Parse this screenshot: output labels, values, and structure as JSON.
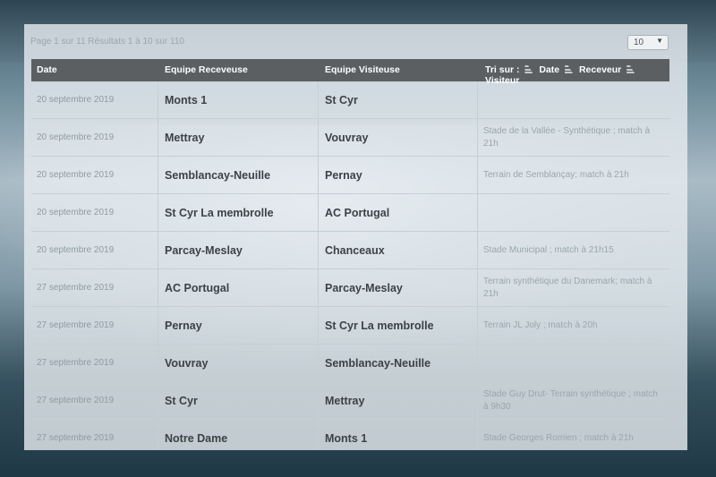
{
  "pager": {
    "info": "Page 1 sur 11 Résultats 1 à 10 sur 110",
    "per_page": "10",
    "per_page_arrow": "▼"
  },
  "columns": {
    "date": "Date",
    "home": "Equipe Receveuse",
    "away": "Equipe Visiteuse",
    "sort_label": "Tri sur :",
    "sort_date": "Date",
    "sort_home": "Receveur",
    "sort_away": "Visiteur"
  },
  "rows": [
    {
      "date": "20 septembre 2019",
      "home": "Monts 1",
      "away": "St Cyr",
      "info": ""
    },
    {
      "date": "20 septembre 2019",
      "home": "Mettray",
      "away": "Vouvray",
      "info": "Stade de la Vallée - Synthétique ; match à 21h"
    },
    {
      "date": "20 septembre 2019",
      "home": "Semblancay-Neuille",
      "away": "Pernay",
      "info": "Terrain de Semblançay; match à 21h"
    },
    {
      "date": "20 septembre 2019",
      "home": "St Cyr La membrolle",
      "away": "AC Portugal",
      "info": ""
    },
    {
      "date": "20 septembre 2019",
      "home": "Parcay-Meslay",
      "away": "Chanceaux",
      "info": "Stade Municipal ; match à 21h15"
    },
    {
      "date": "27 septembre 2019",
      "home": "AC Portugal",
      "away": "Parcay-Meslay",
      "info": "Terrain synthétique du Danemark; match à 21h"
    },
    {
      "date": "27 septembre 2019",
      "home": "Pernay",
      "away": "St Cyr La membrolle",
      "info": "Terrain JL Joly ; match à 20h"
    },
    {
      "date": "27 septembre 2019",
      "home": "Vouvray",
      "away": "Semblancay-Neuille",
      "info": ""
    },
    {
      "date": "27 septembre 2019",
      "home": "St Cyr",
      "away": "Mettray",
      "info": "Stade Guy Drut- Terrain synthétique ; match à 9h30"
    },
    {
      "date": "27 septembre 2019",
      "home": "Notre Dame",
      "away": "Monts 1",
      "info": "Stade Georges Romien ; match à 21h"
    }
  ]
}
